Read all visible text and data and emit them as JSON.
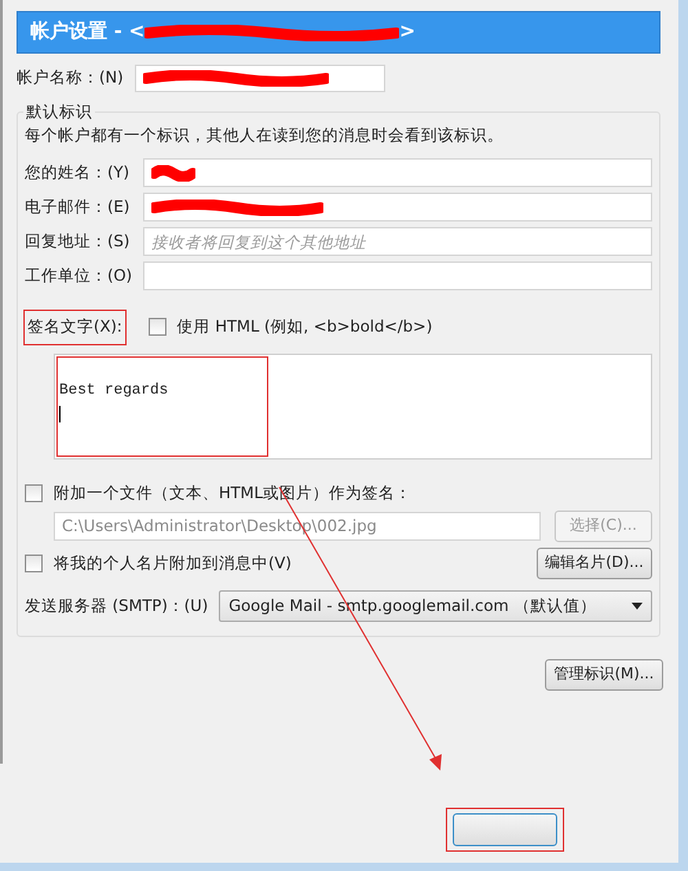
{
  "title": {
    "prefix": "帐户设置 - <",
    "suffix": ">",
    "redacted": true
  },
  "account_name": {
    "label": "帐户名称：(N)",
    "redacted": true
  },
  "identity": {
    "legend": "默认标识",
    "description": "每个帐户都有一个标识，其他人在读到您的消息时会看到该标识。",
    "fields": [
      {
        "label": "您的姓名：(Y)",
        "redacted": true
      },
      {
        "label": "电子邮件：(E)",
        "redacted": true
      },
      {
        "label": "回复地址：(S)",
        "placeholder": "接收者将回复到这个其他地址"
      },
      {
        "label": "工作单位：(O)"
      }
    ],
    "signature": {
      "label": "签名文字(X):",
      "use_html": {
        "label": "使用 HTML (例如, <b>bold</b>)",
        "checked": false
      },
      "text": "Best regards"
    },
    "attach_file": {
      "label": "附加一个文件（文本、HTML或图片）作为签名：",
      "checked": false,
      "path": "C:\\Users\\Administrator\\Desktop\\002.jpg",
      "disabled": true,
      "button": "选择(C)..."
    },
    "attach_vcard": {
      "label": "将我的个人名片附加到消息中(V)",
      "checked": false,
      "button": "编辑名片(D)..."
    },
    "smtp": {
      "label": "发送服务器 (SMTP)：(U)",
      "value": "Google Mail - smtp.googlemail.com （默认值）"
    }
  },
  "manage_button": "管理标识(M)..."
}
